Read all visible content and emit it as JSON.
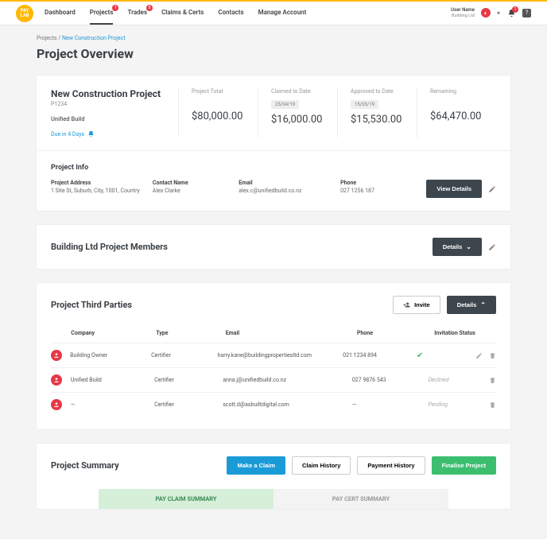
{
  "brand": "PAY LAB",
  "nav": {
    "items": [
      {
        "label": "Dashboard",
        "badge": null,
        "active": false
      },
      {
        "label": "Projects",
        "badge": "1",
        "active": true
      },
      {
        "label": "Trades",
        "badge": "5",
        "active": false
      },
      {
        "label": "Claims & Certs",
        "badge": null,
        "active": false
      },
      {
        "label": "Contacts",
        "badge": null,
        "active": false
      },
      {
        "label": "Manage Account",
        "badge": null,
        "active": false
      }
    ],
    "user": {
      "name": "User Name",
      "org": "Building Ltd"
    },
    "bell_badge": "1"
  },
  "breadcrumb": {
    "root": "Projects",
    "divider": " / ",
    "page": "New Construction Project"
  },
  "page_title": "Project Overview",
  "project": {
    "name": "New Construction Project",
    "code": "P1234",
    "client": "Unified Build",
    "due": "Due in 4 Days",
    "metrics": [
      {
        "label": "Project Total",
        "date": null,
        "value": "$80,000.00"
      },
      {
        "label": "Claimed to Date",
        "date": "25/04/19",
        "value": "$16,000.00"
      },
      {
        "label": "Approved to Date",
        "date": "15/05/19",
        "value": "$15,530.00"
      },
      {
        "label": "Remaining",
        "date": null,
        "value": "$64,470.00"
      }
    ],
    "info_heading": "Project Info",
    "info": {
      "address_lbl": "Project Address",
      "address_val": "1 Site St, Suburb, City, 1001, Country",
      "contact_lbl": "Contact Name",
      "contact_val": "Alex Clarke",
      "email_lbl": "Email",
      "email_val": "alex.c@unifiedbuild.co.nz",
      "phone_lbl": "Phone",
      "phone_val": "027 1256 187"
    },
    "view_details": "View Details"
  },
  "members": {
    "heading": "Building Ltd Project Members",
    "details_btn": "Details"
  },
  "third_parties": {
    "heading": "Project Third Parties",
    "invite_btn": "Invite",
    "details_btn": "Details",
    "columns": {
      "company": "Company",
      "type": "Type",
      "email": "Email",
      "phone": "Phone",
      "status": "Invitation Status"
    },
    "rows": [
      {
        "company": "Building Owner",
        "type": "Certifier",
        "email": "harry.kane@buildingpropertiesltd.com",
        "phone": "021 1234 894",
        "status": "check"
      },
      {
        "company": "Unified Build",
        "type": "Certifier",
        "email": "anna.j@unifiedbuild.co.nz",
        "phone": "027 9876 543",
        "status": "Declined"
      },
      {
        "company": "—",
        "type": "Certifier",
        "email": "scott.d@asbuiltdigital.com",
        "phone": "—",
        "status": "Pending"
      }
    ]
  },
  "summary": {
    "heading": "Project Summary",
    "buttons": {
      "make_claim": "Make a Claim",
      "claim_history": "Claim History",
      "payment_history": "Payment History",
      "finalise": "Finalise Project"
    },
    "tabs": {
      "claim": "PAY CLAIM SUMMARY",
      "cert": "PAY CERT SUMMARY"
    }
  }
}
